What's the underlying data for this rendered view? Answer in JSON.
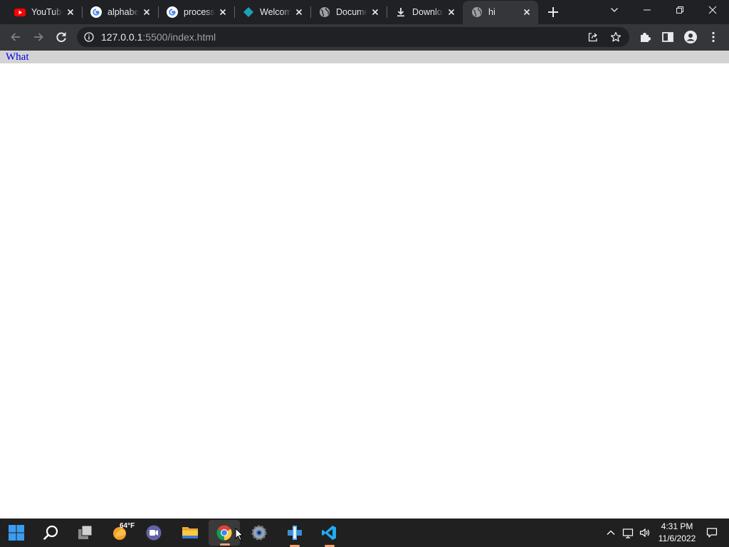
{
  "browser": {
    "tabs": [
      {
        "title": "YouTube",
        "icon": "youtube-icon",
        "active": false
      },
      {
        "title": "alphabet",
        "icon": "google-icon",
        "active": false
      },
      {
        "title": "process",
        "icon": "google-icon",
        "active": false
      },
      {
        "title": "Welcome",
        "icon": "vscode-diamond-icon",
        "active": false
      },
      {
        "title": "Document",
        "icon": "globe-icon",
        "active": false
      },
      {
        "title": "Downloads",
        "icon": "download-icon",
        "active": false
      },
      {
        "title": "hi",
        "icon": "globe-icon",
        "active": true
      }
    ],
    "address": {
      "host": "127.0.0.1",
      "rest": ":5500/index.html"
    }
  },
  "page": {
    "link_text": "What"
  },
  "taskbar": {
    "weather_temp": "64°F",
    "apps": [
      "start-icon",
      "search-icon",
      "task-view-icon",
      "weather-icon",
      "teams-chat-icon",
      "file-explorer-icon",
      "chrome-icon",
      "settings-icon",
      "network-tool-icon",
      "vscode-icon"
    ],
    "active_app": "chrome-icon",
    "clock": {
      "time": "4:31 PM",
      "date": "11/6/2022"
    }
  },
  "colors": {
    "tabstrip_bg": "#202124",
    "toolbar_bg": "#35363a",
    "omnibox_bg": "#202124",
    "page_bar_bg": "#d3d3d3",
    "link_color": "#0000ee",
    "taskbar_bg": "#202020"
  }
}
